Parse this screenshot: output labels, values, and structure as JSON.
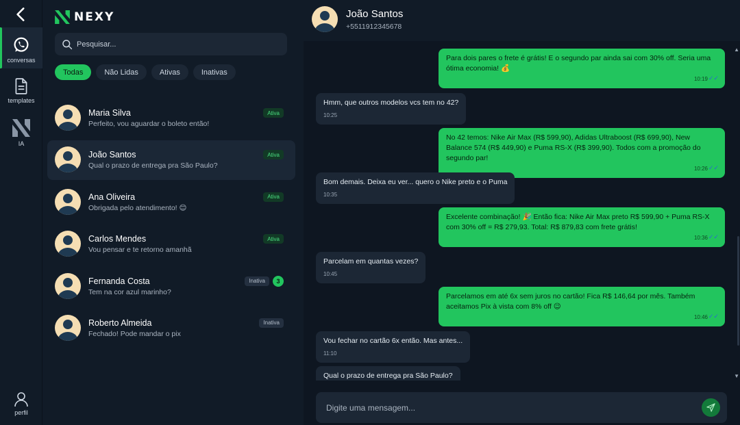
{
  "rail": {
    "items": [
      {
        "label": "conversas"
      },
      {
        "label": "templates"
      },
      {
        "label": "IA"
      },
      {
        "label": "perfil"
      }
    ]
  },
  "brand": {
    "name": "NEXY",
    "accent": "#22c55e"
  },
  "search": {
    "placeholder": "Pesquisar..."
  },
  "filters": [
    "Todas",
    "Não Lidas",
    "Ativas",
    "Inativas"
  ],
  "conversations": [
    {
      "name": "Maria Silva",
      "preview": "Perfeito, vou aguardar o boleto então!",
      "status": "Ativa"
    },
    {
      "name": "João Santos",
      "preview": "Qual o prazo de entrega pra São Paulo?",
      "status": "Ativa"
    },
    {
      "name": "Ana Oliveira",
      "preview": "Obrigada pelo atendimento! 😊",
      "status": "Ativa"
    },
    {
      "name": "Carlos Mendes",
      "preview": "Vou pensar e te retorno amanhã",
      "status": "Ativa"
    },
    {
      "name": "Fernanda Costa",
      "preview": "Tem na cor azul marinho?",
      "status": "Inativa",
      "unread": "3"
    },
    {
      "name": "Roberto Almeida",
      "preview": "Fechado! Pode mandar o pix",
      "status": "Inativa"
    }
  ],
  "chat": {
    "name": "João Santos",
    "phone": "+5511912345678",
    "messages": [
      {
        "dir": "out",
        "text": "Para dois pares o frete é grátis! E o segundo par ainda sai com 30% off. Seria uma ótima economia! 💰",
        "time": "10:19"
      },
      {
        "dir": "in",
        "text": "Hmm, que outros modelos vcs tem no 42?",
        "time": "10:25"
      },
      {
        "dir": "out",
        "text": "No 42 temos: Nike Air Max (R$ 599,90), Adidas Ultraboost (R$ 699,90), New Balance 574 (R$ 449,90) e Puma RS-X (R$ 399,90). Todos com a promoção do segundo par!",
        "time": "10:26"
      },
      {
        "dir": "in",
        "text": "Bom demais. Deixa eu ver... quero o Nike preto e o Puma",
        "time": "10:35"
      },
      {
        "dir": "out",
        "text": "Excelente combinação! 🎉 Então fica: Nike Air Max preto R$ 599,90 + Puma RS-X com 30% off = R$ 279,93. Total: R$ 879,83 com frete grátis!",
        "time": "10:36"
      },
      {
        "dir": "in",
        "text": "Parcelam em quantas vezes?",
        "time": "10:45"
      },
      {
        "dir": "out",
        "text": "Parcelamos em até 6x sem juros no cartão! Fica R$ 146,64 por mês. Também aceitamos Pix à vista com 8% off 😉",
        "time": "10:46"
      },
      {
        "dir": "in",
        "text": "Vou fechar no cartão 6x então. Mas antes...",
        "time": "11:10"
      },
      {
        "dir": "in",
        "text": "Qual o prazo de entrega pra São Paulo?",
        "time": ""
      }
    ]
  },
  "composer": {
    "placeholder": "Digite uma mensagem..."
  },
  "ticks": "✓✓"
}
